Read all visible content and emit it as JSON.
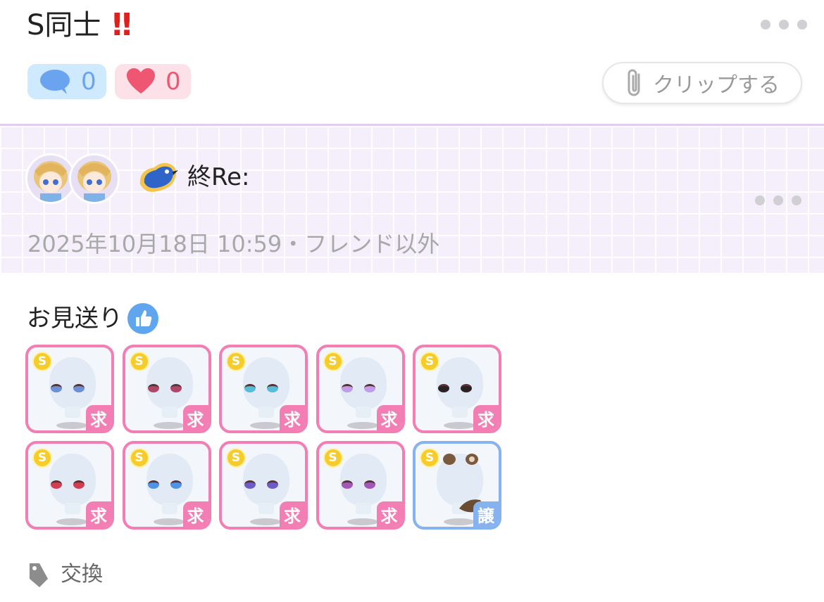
{
  "post": {
    "title": "S同士",
    "emphasis": "‼",
    "comment_count": "0",
    "like_count": "0",
    "clip_label": "クリップする"
  },
  "author": {
    "name": "終Re:",
    "timestamp": "2025年10月18日 10:59・フレンド以外"
  },
  "body": {
    "heading": "お見送り"
  },
  "items": [
    {
      "coin": "S",
      "tag": "求",
      "eye_color": "#6d8fd6"
    },
    {
      "coin": "S",
      "tag": "求",
      "eye_color": "#b0476b"
    },
    {
      "coin": "S",
      "tag": "求",
      "eye_color": "#57bcd6"
    },
    {
      "coin": "S",
      "tag": "求",
      "eye_color": "#c39be8"
    },
    {
      "coin": "S",
      "tag": "求",
      "eye_color": "#2a2222"
    },
    {
      "coin": "S",
      "tag": "求",
      "eye_color": "#d33d4f"
    },
    {
      "coin": "S",
      "tag": "求",
      "eye_color": "#4f93e8"
    },
    {
      "coin": "S",
      "tag": "求",
      "eye_color": "#6f5bc6"
    },
    {
      "coin": "S",
      "tag": "求",
      "eye_color": "#a357b8"
    },
    {
      "coin": "S",
      "tag": "譲",
      "eye_color": ""
    }
  ],
  "footer": {
    "tag_label": "交換"
  },
  "colors": {
    "want_border": "#f27eb3",
    "give_border": "#86b2ef",
    "band_bg": "#f5effc"
  }
}
